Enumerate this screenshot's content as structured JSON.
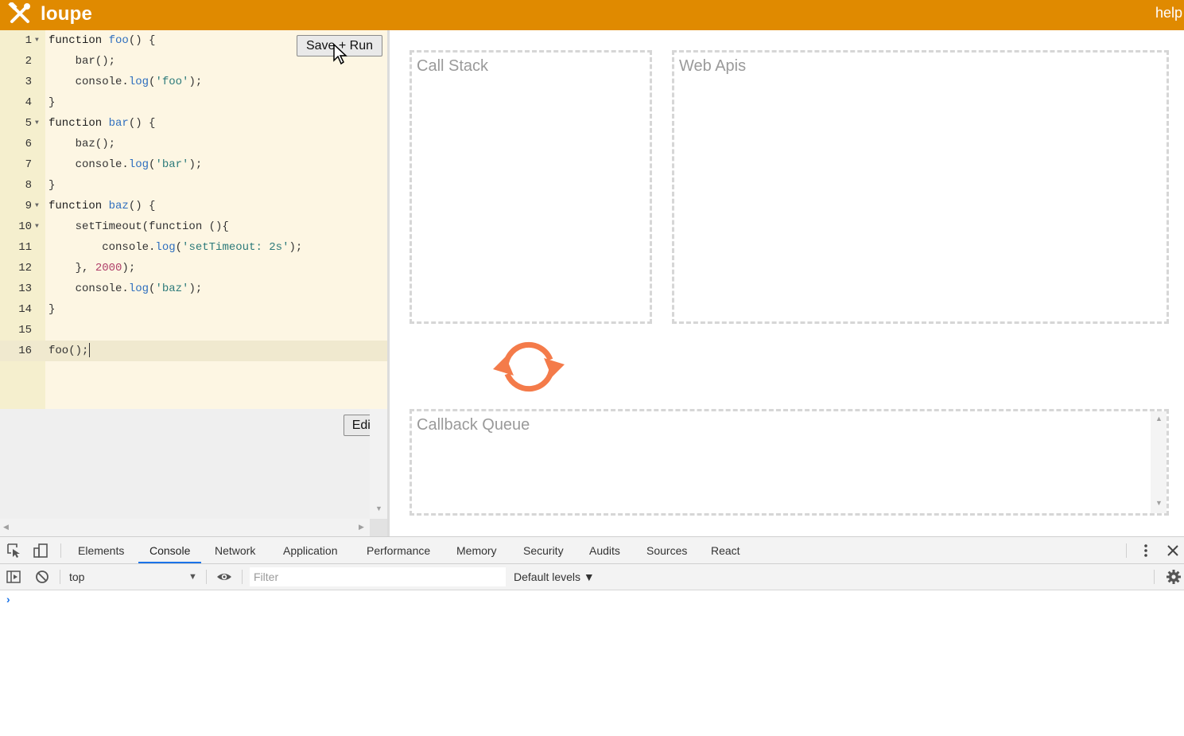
{
  "header": {
    "brand": "loupe",
    "help": "help",
    "color": "#e08a00"
  },
  "editor": {
    "save_label": "Save + Run",
    "lines": [
      {
        "n": "1",
        "fold": true,
        "tokens": [
          [
            "kw",
            "function "
          ],
          [
            "fn",
            "foo"
          ],
          [
            "p",
            "() {"
          ]
        ]
      },
      {
        "n": "2",
        "fold": false,
        "tokens": [
          [
            "p",
            "    bar();"
          ]
        ]
      },
      {
        "n": "3",
        "fold": false,
        "tokens": [
          [
            "p",
            "    console."
          ],
          [
            "fn",
            "log"
          ],
          [
            "p",
            "("
          ],
          [
            "str",
            "'foo'"
          ],
          [
            "p",
            ");"
          ]
        ]
      },
      {
        "n": "4",
        "fold": false,
        "tokens": [
          [
            "p",
            "}"
          ]
        ]
      },
      {
        "n": "5",
        "fold": true,
        "tokens": [
          [
            "kw",
            "function "
          ],
          [
            "fn",
            "bar"
          ],
          [
            "p",
            "() {"
          ]
        ]
      },
      {
        "n": "6",
        "fold": false,
        "tokens": [
          [
            "p",
            "    baz();"
          ]
        ]
      },
      {
        "n": "7",
        "fold": false,
        "tokens": [
          [
            "p",
            "    console."
          ],
          [
            "fn",
            "log"
          ],
          [
            "p",
            "("
          ],
          [
            "str",
            "'bar'"
          ],
          [
            "p",
            ");"
          ]
        ]
      },
      {
        "n": "8",
        "fold": false,
        "tokens": [
          [
            "p",
            "}"
          ]
        ]
      },
      {
        "n": "9",
        "fold": true,
        "tokens": [
          [
            "kw",
            "function "
          ],
          [
            "fn",
            "baz"
          ],
          [
            "p",
            "() {"
          ]
        ]
      },
      {
        "n": "10",
        "fold": true,
        "tokens": [
          [
            "p",
            "    setTimeout(function (){"
          ]
        ]
      },
      {
        "n": "11",
        "fold": false,
        "tokens": [
          [
            "p",
            "        console."
          ],
          [
            "fn",
            "log"
          ],
          [
            "p",
            "("
          ],
          [
            "str",
            "'setTimeout: 2s'"
          ],
          [
            "p",
            ");"
          ]
        ]
      },
      {
        "n": "12",
        "fold": false,
        "tokens": [
          [
            "p",
            "    }, "
          ],
          [
            "num",
            "2000"
          ],
          [
            "p",
            ");"
          ]
        ]
      },
      {
        "n": "13",
        "fold": false,
        "tokens": [
          [
            "p",
            "    console."
          ],
          [
            "fn",
            "log"
          ],
          [
            "p",
            "("
          ],
          [
            "str",
            "'baz'"
          ],
          [
            "p",
            ");"
          ]
        ]
      },
      {
        "n": "14",
        "fold": false,
        "tokens": [
          [
            "p",
            "}"
          ]
        ]
      },
      {
        "n": "15",
        "fold": false,
        "tokens": []
      },
      {
        "n": "16",
        "fold": false,
        "active": true,
        "tokens": [
          [
            "p",
            "foo();"
          ]
        ]
      }
    ]
  },
  "output": {
    "edit_label": "Edit"
  },
  "viz": {
    "call_stack": "Call Stack",
    "web_apis": "Web Apis",
    "callback_queue": "Callback Queue",
    "loop_color": "#f47b4a"
  },
  "devtools": {
    "tabs": [
      "Elements",
      "Console",
      "Network",
      "Application",
      "Performance",
      "Memory",
      "Security",
      "Audits",
      "Sources",
      "React"
    ],
    "active_tab": "Console",
    "context": "top",
    "filter_placeholder": "Filter",
    "levels": "Default levels ▼",
    "prompt": "›",
    "accent": "#1a73e8"
  }
}
